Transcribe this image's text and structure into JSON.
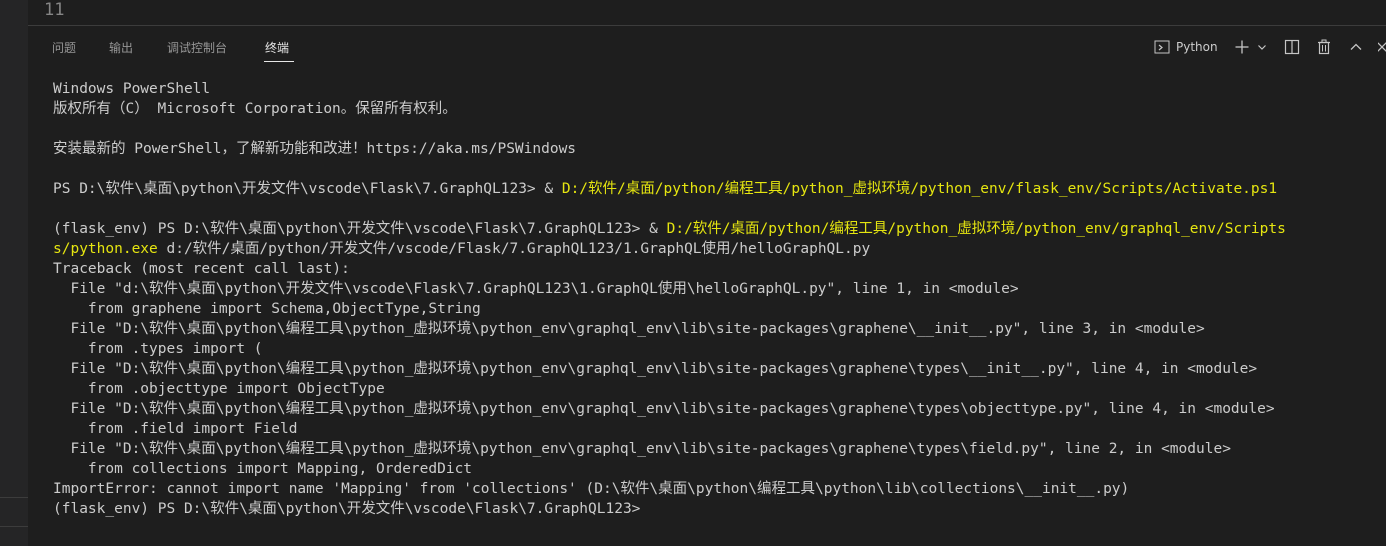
{
  "editor": {
    "line_number": "11"
  },
  "panel": {
    "tabs": [
      {
        "label": "问题"
      },
      {
        "label": "输出"
      },
      {
        "label": "调试控制台"
      },
      {
        "label": "终端",
        "active": true
      }
    ],
    "toolbar": {
      "profile_label": "Python",
      "icons": [
        "terminal-icon",
        "plus-icon",
        "chevron-down-icon",
        "split-icon",
        "trash-icon",
        "chevron-up-icon",
        "close-icon"
      ]
    }
  },
  "terminal": {
    "colors": {
      "text": "#cccccc",
      "highlight": "#e5e510",
      "background": "#1e1e1e"
    },
    "lines": [
      {
        "text": "Windows PowerShell"
      },
      {
        "text": "版权所有（C） Microsoft Corporation。保留所有权利。"
      },
      {
        "text": ""
      },
      {
        "text": "安装最新的 PowerShell，了解新功能和改进！https://aka.ms/PSWindows"
      },
      {
        "text": ""
      },
      {
        "text": "PS D:\\软件\\桌面\\python\\开发文件\\vscode\\Flask\\7.GraphQL123> & ",
        "highlight": "D:/软件/桌面/python/编程工具/python_虚拟环境/python_env/flask_env/Scripts/Activate.ps1"
      },
      {
        "text": ""
      },
      {
        "text": "(flask_env) PS D:\\软件\\桌面\\python\\开发文件\\vscode\\Flask\\7.GraphQL123> & ",
        "highlight": "D:/软件/桌面/python/编程工具/python_虚拟环境/python_env/graphql_env/Scripts"
      },
      {
        "highlight_prefix": "s/python.exe",
        "text": " d:/软件/桌面/python/开发文件/vscode/Flask/7.GraphQL123/1.GraphQL使用/helloGraphQL.py"
      },
      {
        "text": "Traceback (most recent call last):"
      },
      {
        "text": "  File \"d:\\软件\\桌面\\python\\开发文件\\vscode\\Flask\\7.GraphQL123\\1.GraphQL使用\\helloGraphQL.py\", line 1, in <module>"
      },
      {
        "text": "    from graphene import Schema,ObjectType,String"
      },
      {
        "text": "  File \"D:\\软件\\桌面\\python\\编程工具\\python_虚拟环境\\python_env\\graphql_env\\lib\\site-packages\\graphene\\__init__.py\", line 3, in <module>"
      },
      {
        "text": "    from .types import ("
      },
      {
        "text": "  File \"D:\\软件\\桌面\\python\\编程工具\\python_虚拟环境\\python_env\\graphql_env\\lib\\site-packages\\graphene\\types\\__init__.py\", line 4, in <module>"
      },
      {
        "text": "    from .objecttype import ObjectType"
      },
      {
        "text": "  File \"D:\\软件\\桌面\\python\\编程工具\\python_虚拟环境\\python_env\\graphql_env\\lib\\site-packages\\graphene\\types\\objecttype.py\", line 4, in <module>"
      },
      {
        "text": "    from .field import Field"
      },
      {
        "text": "  File \"D:\\软件\\桌面\\python\\编程工具\\python_虚拟环境\\python_env\\graphql_env\\lib\\site-packages\\graphene\\types\\field.py\", line 2, in <module>"
      },
      {
        "text": "    from collections import Mapping, OrderedDict"
      },
      {
        "text": "ImportError: cannot import name 'Mapping' from 'collections' (D:\\软件\\桌面\\python\\编程工具\\python\\lib\\collections\\__init__.py)"
      },
      {
        "text": "(flask_env) PS D:\\软件\\桌面\\python\\开发文件\\vscode\\Flask\\7.GraphQL123>"
      }
    ]
  }
}
